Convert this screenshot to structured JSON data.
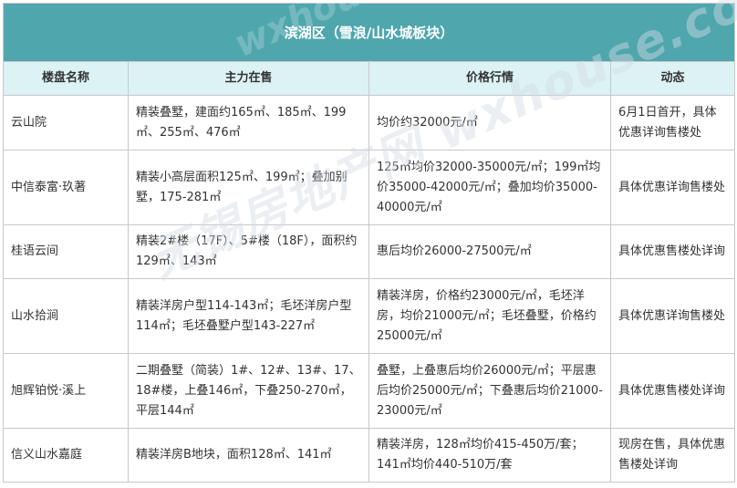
{
  "table": {
    "title": "滨湖区（雪浪/山水城板块）",
    "headers": [
      "楼盘名称",
      "主力在售",
      "价格行情",
      "动态"
    ],
    "rows": [
      {
        "name": "云山院",
        "product": "精装叠墅，建面约165㎡、185㎡、199㎡、255㎡、476㎡",
        "price": "均价约32000元/㎡",
        "status": "6月1日首开，具体优惠详询售楼处"
      },
      {
        "name": "中信泰富·玖著",
        "product": "精装小高层面积125㎡、199㎡；叠加别墅，175-281㎡",
        "price": "125㎡均价32000-35000元/㎡；199㎡均价35000-42000元/㎡；叠加均价35000-40000元/㎡",
        "status": "具体优惠详询售楼处"
      },
      {
        "name": "桂语云间",
        "product": "精装2#楼（17F）、5#楼（18F），面积约129㎡、143㎡",
        "price": "惠后均价26000-27500元/㎡",
        "status": "具体优惠售楼处详询"
      },
      {
        "name": "山水拾涧",
        "product": "精装洋房户型114-143㎡；毛坯洋房户型114㎡；毛坯叠墅户型143-227㎡",
        "price": "精装洋房，价格约23000元/㎡，毛坯洋房，均价21000元/㎡；毛坯叠墅，价格约25000元/㎡",
        "status": "具体优惠详询售楼处"
      },
      {
        "name": "旭辉铂悦·溪上",
        "product": "二期叠墅（简装）1#、12#、13#、17、18#楼，上叠146㎡，下叠250-270㎡，平层144㎡",
        "price": "叠墅，上叠惠后均价26000元/㎡；平层惠后均价25000元/㎡；下叠惠后均价21000-23000元/㎡",
        "status": "具体优惠售楼处详询"
      },
      {
        "name": "信义山水嘉庭",
        "product": "精装洋房B地块，面积128㎡、141㎡",
        "price": "精装洋房，128㎡均价415-450万/套；141㎡均价440-510万/套",
        "status": "现房在售，具体优惠售楼处详询"
      }
    ]
  },
  "watermark": {
    "line1": "无锡房地产网 wxhouse.com",
    "line2": "wxhouse.com"
  },
  "colors": {
    "title_bg": "#4fa6ad",
    "header_bg": "#dcf2f4",
    "border": "#c8c8c8"
  }
}
